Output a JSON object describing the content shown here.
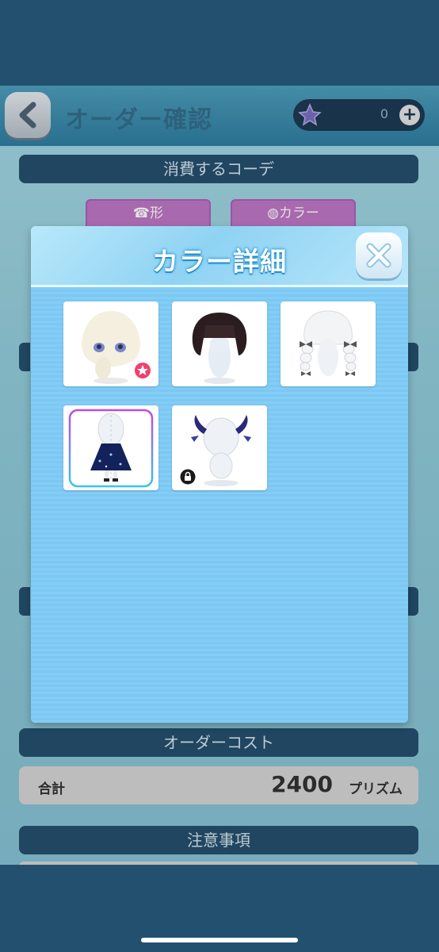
{
  "header": {
    "title": "オーダー確認",
    "currency_count": "0"
  },
  "sections": {
    "consume_coords": "消費するコーデ",
    "order_cost": "オーダーコスト",
    "notes": "注意事項"
  },
  "tabs": [
    {
      "label": "形"
    },
    {
      "label": "カラー"
    }
  ],
  "total": {
    "label": "合計",
    "value": "2400",
    "unit": "プリズム"
  },
  "modal": {
    "title": "カラー詳細",
    "items": [
      {
        "icon": "head-item-icon",
        "badge": "star-badge"
      },
      {
        "icon": "black-bob-hair-icon"
      },
      {
        "icon": "white-braided-hair-icon"
      },
      {
        "icon": "starry-dress-outfit-icon",
        "selected": true
      },
      {
        "icon": "horn-accessory-icon",
        "badge": "locked-badge"
      }
    ]
  },
  "colors": {
    "modal_header": "#8fd3f3",
    "modal_body": "#83cdf6",
    "section_bar": "#25506f",
    "tab": "#c078c8",
    "title_stroke": "#1f8fcf"
  }
}
